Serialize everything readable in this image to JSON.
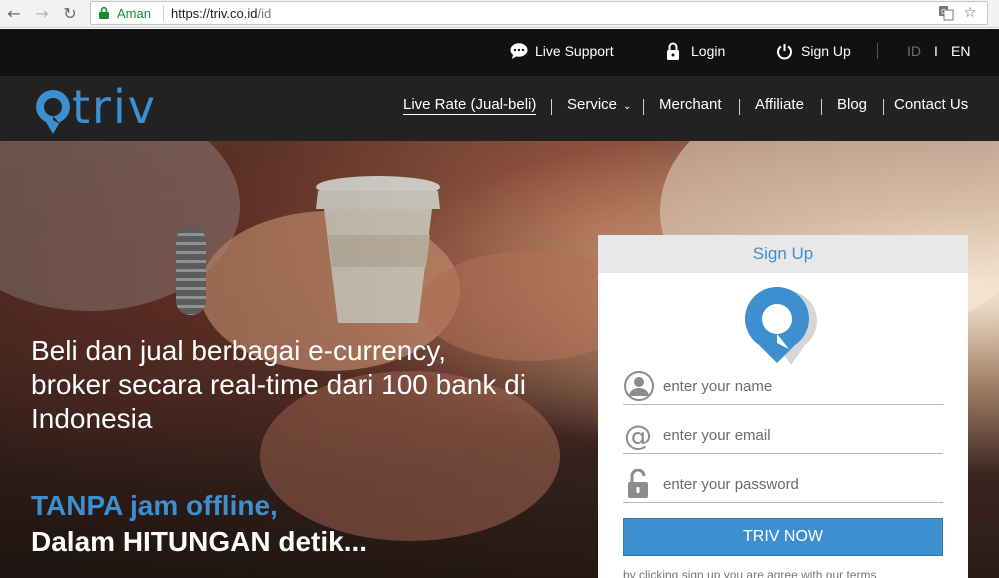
{
  "browser": {
    "secure_label": "Aman",
    "url_host": "https://triv.co.id",
    "url_path": "/id"
  },
  "topbar": {
    "live_support": "Live Support",
    "login": "Login",
    "signup": "Sign Up",
    "lang_id": "ID",
    "lang_sep": "I",
    "lang_en": "EN"
  },
  "header": {
    "logo_text": "triv",
    "menu": {
      "live_rate": "Live Rate (Jual-beli)",
      "service": "Service",
      "merchant": "Merchant",
      "affiliate": "Affiliate",
      "blog": "Blog",
      "contact": "Contact Us"
    }
  },
  "hero": {
    "headline_1": "Beli dan jual berbagai e-currency,",
    "headline_2": "broker secara real-time dari 100 bank di",
    "headline_3": "Indonesia",
    "tagline_1": "TANPA jam offline,",
    "tagline_2": "Dalam HITUNGAN detik..."
  },
  "signup_card": {
    "title": "Sign Up",
    "name_placeholder": "enter your name",
    "email_placeholder": "enter your email",
    "password_placeholder": "enter your password",
    "submit_label": "TRIV NOW",
    "terms_text": "by clicking sign up you are agree with our terms"
  },
  "colors": {
    "accent": "#3d8fcf",
    "topbar_bg": "#111111",
    "header_bg": "#222222"
  }
}
